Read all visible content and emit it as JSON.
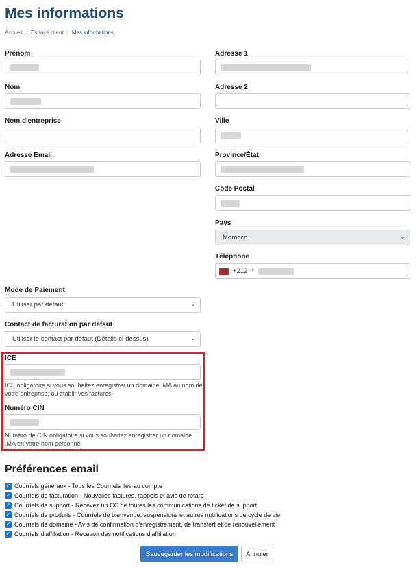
{
  "header": {
    "title": "Mes informations",
    "breadcrumb": [
      "Accueil",
      "Espace client",
      "Mes informations"
    ]
  },
  "left_fields": {
    "prenom": "Prénom",
    "nom": "Nom",
    "entreprise": "Nom d'entreprise",
    "email": "Adresse Email"
  },
  "right_fields": {
    "adresse1": "Adresse 1",
    "adresse2": "Adresse 2",
    "ville": "Ville",
    "province": "Province/État",
    "code_postal": "Code Postal",
    "pays": "Pays",
    "pays_value": "Morocco",
    "telephone": "Téléphone",
    "phone_code": "+212"
  },
  "payment": {
    "mode_label": "Mode de Paiement",
    "mode_value": "Utiliser par défaut",
    "contact_label": "Contact de facturation par défaut",
    "contact_value": "Utiliser le contact par défaut (Détails ci-dessus)"
  },
  "ice": {
    "label": "ICE",
    "help": "ICE obligatoire si vous souhaitez enregistrer un domaine .MA au nom de votre entreprise, ou établir vos factures"
  },
  "cin": {
    "label": "Numéro CIN",
    "help": "Numéro de CIN obligatoire si vous souhaitez enregistrer un domaine .MA en votre nom personnel"
  },
  "email_prefs": {
    "title": "Préférences email",
    "items": [
      "Courriels généraux - Tous les Courriels liés au compte",
      "Courriels de facturation - Nouvelles factures, rappels et avis de retard",
      "Courriels de support - Recevez un CC de toutes les communications de ticket de support",
      "Courriels de produits - Courriels de bienvenue, suspensions et autres notifications de cycle de vie",
      "Courriels de domaine - Avis de confirmation d'enregistrement, de transfert et de renouvellement",
      "Courriels d'affiliation - Recevoir des notifications d'affiliation"
    ]
  },
  "actions": {
    "save": "Sauvegarder les modifications",
    "cancel": "Annuler"
  },
  "colors": {
    "accent": "#1f4e79",
    "primary_button": "#3b7ac9",
    "highlight_border": "#d6212a",
    "checkbox": "#1a73c8"
  }
}
